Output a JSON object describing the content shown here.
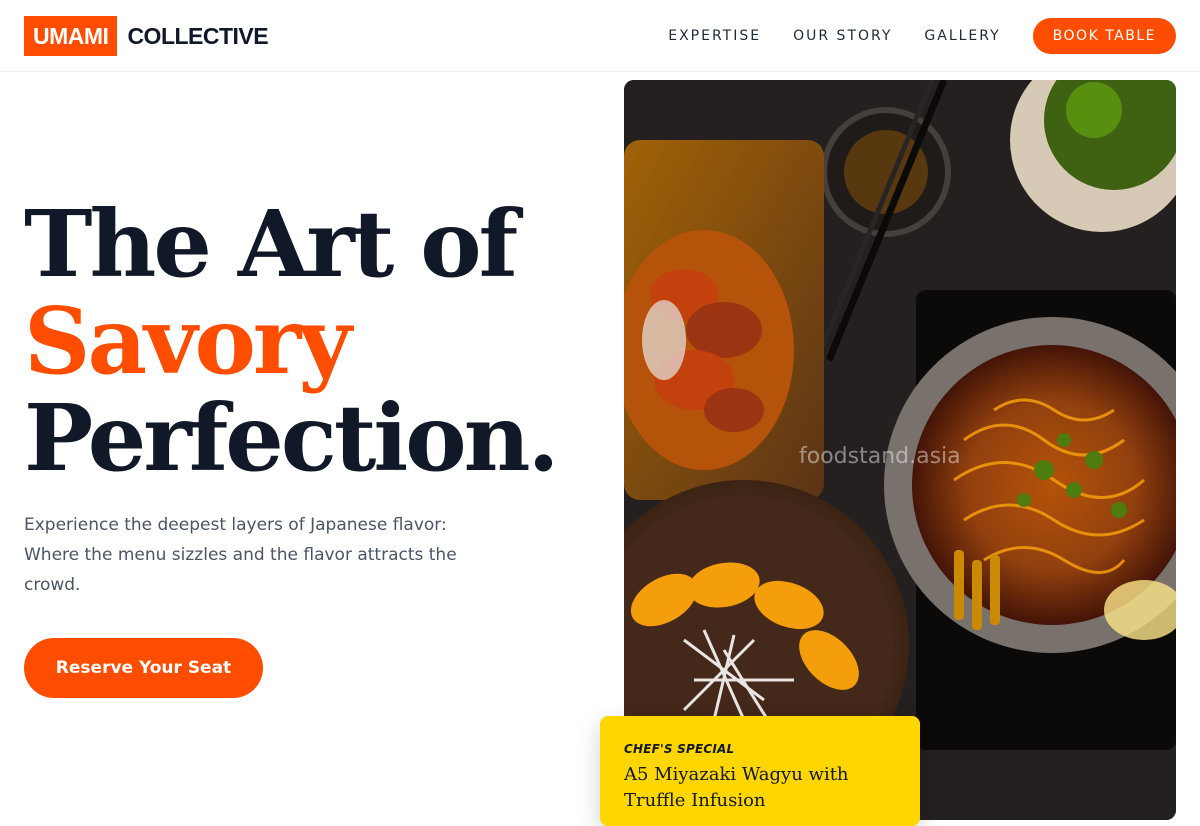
{
  "brand": {
    "box": "UMAMI",
    "word": "COLLECTIVE",
    "accent_color": "#ff4d00"
  },
  "nav": {
    "links": [
      "EXPERTISE",
      "OUR STORY",
      "GALLERY"
    ],
    "cta": "BOOK TABLE"
  },
  "hero": {
    "line1": "The Art of",
    "accent": "Savory",
    "line3": "Perfection.",
    "subtitle": "Experience the deepest layers of Japanese flavor: Where the menu sizzles and the flavor attracts the crowd.",
    "cta": "Reserve Your Seat"
  },
  "photo": {
    "description": "food-photo",
    "watermark": "foodstand.asia"
  },
  "special": {
    "kicker": "CHEF'S SPECIAL",
    "title": "A5 Miyazaki Wagyu with Truffle Infusion"
  }
}
